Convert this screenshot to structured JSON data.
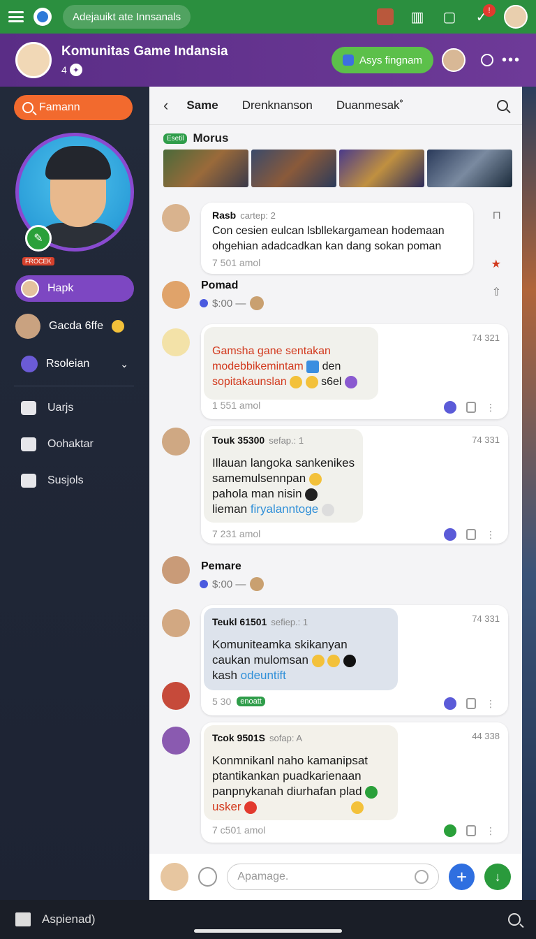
{
  "topbar": {
    "search_label": "Adejauikt ate Innsanals"
  },
  "header": {
    "title": "Komunitas Game Indansia",
    "subtitle": "4",
    "join_label": "Asys fingnam"
  },
  "sidebar": {
    "search_label": "Famann",
    "level_badge": "FROCEK",
    "items": [
      {
        "label": "Hapk"
      },
      {
        "label": "Gacda 6ffe"
      },
      {
        "label": "Rsoleian"
      }
    ],
    "links": [
      {
        "label": "Uarjs"
      },
      {
        "label": "Oohaktar"
      },
      {
        "label": "Susjols"
      }
    ]
  },
  "tabs": [
    {
      "label": "Same"
    },
    {
      "label": "Drenknanson"
    },
    {
      "label": "Duanmesak˚"
    }
  ],
  "gallery": {
    "tag": "Esetil",
    "title": "Morus"
  },
  "messages": [
    {
      "name": "Rasb",
      "sub": "cartep: 2",
      "lines": [
        "Con cesien eulcan lsbllekargamean hodemaan",
        "ohgehian adadcadkan kan dang sokan poman"
      ],
      "time": "7 501 amol"
    },
    {
      "name": "Pomad",
      "meta": "$:00 —"
    },
    {
      "lines": [
        "Gamsha gane sentakan",
        "modebbikemintam",
        "den",
        "sopitakaunslan",
        "s6el"
      ],
      "corner_time": "74 321",
      "time": "1 551 amol"
    },
    {
      "name": "Touk 35300",
      "sub": "sefap.: 1",
      "lines": [
        "Illauan langoka sankenikes",
        "samemulsennpan",
        "pahola man nisin",
        "lieman",
        "firyalanntoge"
      ],
      "corner_time": "74 331",
      "time": "7 231 amol"
    },
    {
      "name": "Pemare",
      "meta": "$:00 —"
    },
    {
      "name": "Teukl 61501",
      "sub": "sefiep.: 1",
      "lines": [
        "Komuniteamka skikanyan",
        "caukan mulomsan",
        "kash",
        "odeuntift"
      ],
      "corner_time": "74 331",
      "time": "5 30",
      "tag": "enoatt"
    },
    {
      "name": "Tcok 9501S",
      "sub": "sofap: A",
      "lines": [
        "Konmnikanl naho kamanipsat",
        "ptantikankan puadkarienaan",
        "panpnykanah diurhafan plad",
        "usker"
      ],
      "corner_time": "44 338",
      "time": "7 c501 amol"
    }
  ],
  "composer": {
    "placeholder": "Apamage."
  },
  "bottombar": {
    "label": "Aspienad)"
  },
  "colors": {
    "green": "#2b8f3f",
    "purple": "#5a2d86",
    "orange": "#f26a2e",
    "active": "#7d47c2"
  }
}
